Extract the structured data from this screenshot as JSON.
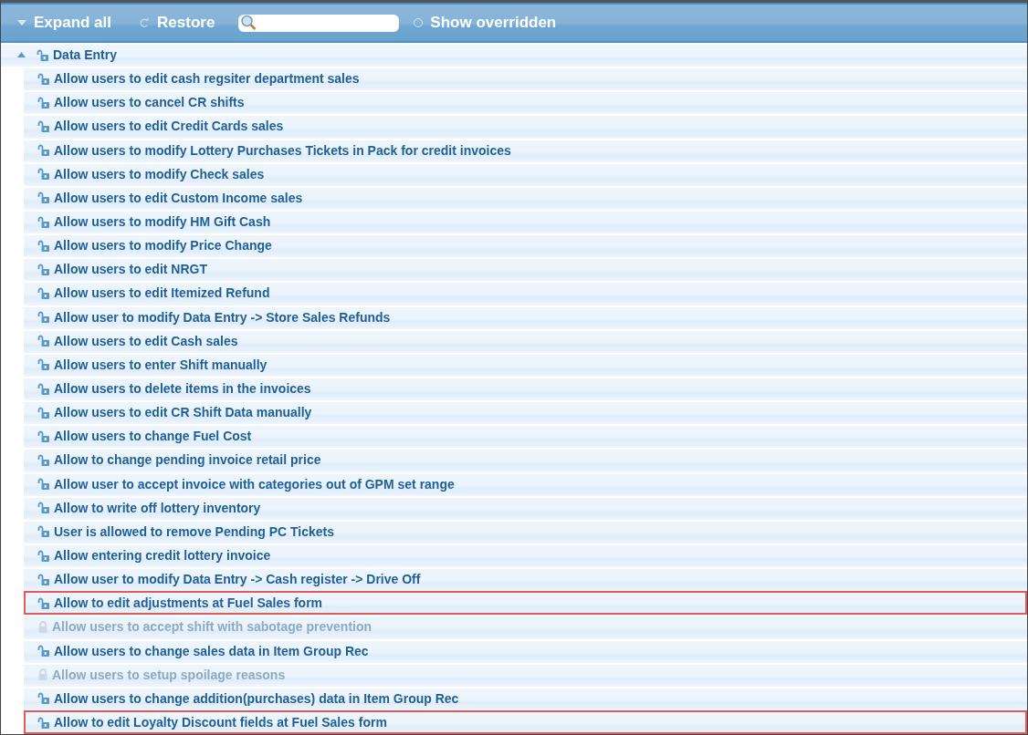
{
  "toolbar": {
    "expand_all": "Expand all",
    "restore": "Restore",
    "show_overridden": {
      "label": "Show overridden",
      "selected": false
    }
  },
  "tree": {
    "label": "Data Entry",
    "expanded": true,
    "children": [
      {
        "label": "Allow users to edit cash regsiter department sales",
        "disabled": false,
        "highlighted": false
      },
      {
        "label": "Allow users to cancel CR shifts",
        "disabled": false,
        "highlighted": false
      },
      {
        "label": "Allow users to edit Credit Cards sales",
        "disabled": false,
        "highlighted": false
      },
      {
        "label": "Allow users to modify Lottery Purchases Tickets in Pack for credit invoices",
        "disabled": false,
        "highlighted": false
      },
      {
        "label": "Allow users to modify Check sales",
        "disabled": false,
        "highlighted": false
      },
      {
        "label": "Allow users to edit Custom Income sales",
        "disabled": false,
        "highlighted": false
      },
      {
        "label": "Allow users to modify HM Gift Cash",
        "disabled": false,
        "highlighted": false
      },
      {
        "label": "Allow users to modify Price Change",
        "disabled": false,
        "highlighted": false
      },
      {
        "label": "Allow users to edit NRGT",
        "disabled": false,
        "highlighted": false
      },
      {
        "label": "Allow users to edit Itemized Refund",
        "disabled": false,
        "highlighted": false
      },
      {
        "label": "Allow user to modify Data Entry -> Store Sales Refunds",
        "disabled": false,
        "highlighted": false
      },
      {
        "label": "Allow users to edit Cash sales",
        "disabled": false,
        "highlighted": false
      },
      {
        "label": "Allow users to enter Shift manually",
        "disabled": false,
        "highlighted": false
      },
      {
        "label": "Allow users to delete items in the invoices",
        "disabled": false,
        "highlighted": false
      },
      {
        "label": "Allow users to edit CR Shift Data manually",
        "disabled": false,
        "highlighted": false
      },
      {
        "label": "Allow users to change Fuel Cost",
        "disabled": false,
        "highlighted": false
      },
      {
        "label": "Allow to change pending invoice retail price",
        "disabled": false,
        "highlighted": false
      },
      {
        "label": "Allow user to accept invoice with categories out of GPM set range",
        "disabled": false,
        "highlighted": false
      },
      {
        "label": "Allow to write off lottery inventory",
        "disabled": false,
        "highlighted": false
      },
      {
        "label": "User is allowed to remove Pending PC Tickets",
        "disabled": false,
        "highlighted": false
      },
      {
        "label": "Allow entering credit lottery invoice",
        "disabled": false,
        "highlighted": false
      },
      {
        "label": "Allow user to modify Data Entry -> Cash register -> Drive Off",
        "disabled": false,
        "highlighted": false
      },
      {
        "label": "Allow to edit adjustments at Fuel Sales form",
        "disabled": false,
        "highlighted": true
      },
      {
        "label": "Allow users to accept shift with sabotage prevention",
        "disabled": true,
        "highlighted": false
      },
      {
        "label": "Allow users to change sales data in Item Group Rec",
        "disabled": false,
        "highlighted": false
      },
      {
        "label": "Allow users to setup spoilage reasons",
        "disabled": true,
        "highlighted": false
      },
      {
        "label": "Allow users to change addition(purchases) data in Item Group Rec",
        "disabled": false,
        "highlighted": false
      },
      {
        "label": "Allow to edit Loyalty Discount fields at Fuel Sales form",
        "disabled": false,
        "highlighted": true
      }
    ]
  }
}
